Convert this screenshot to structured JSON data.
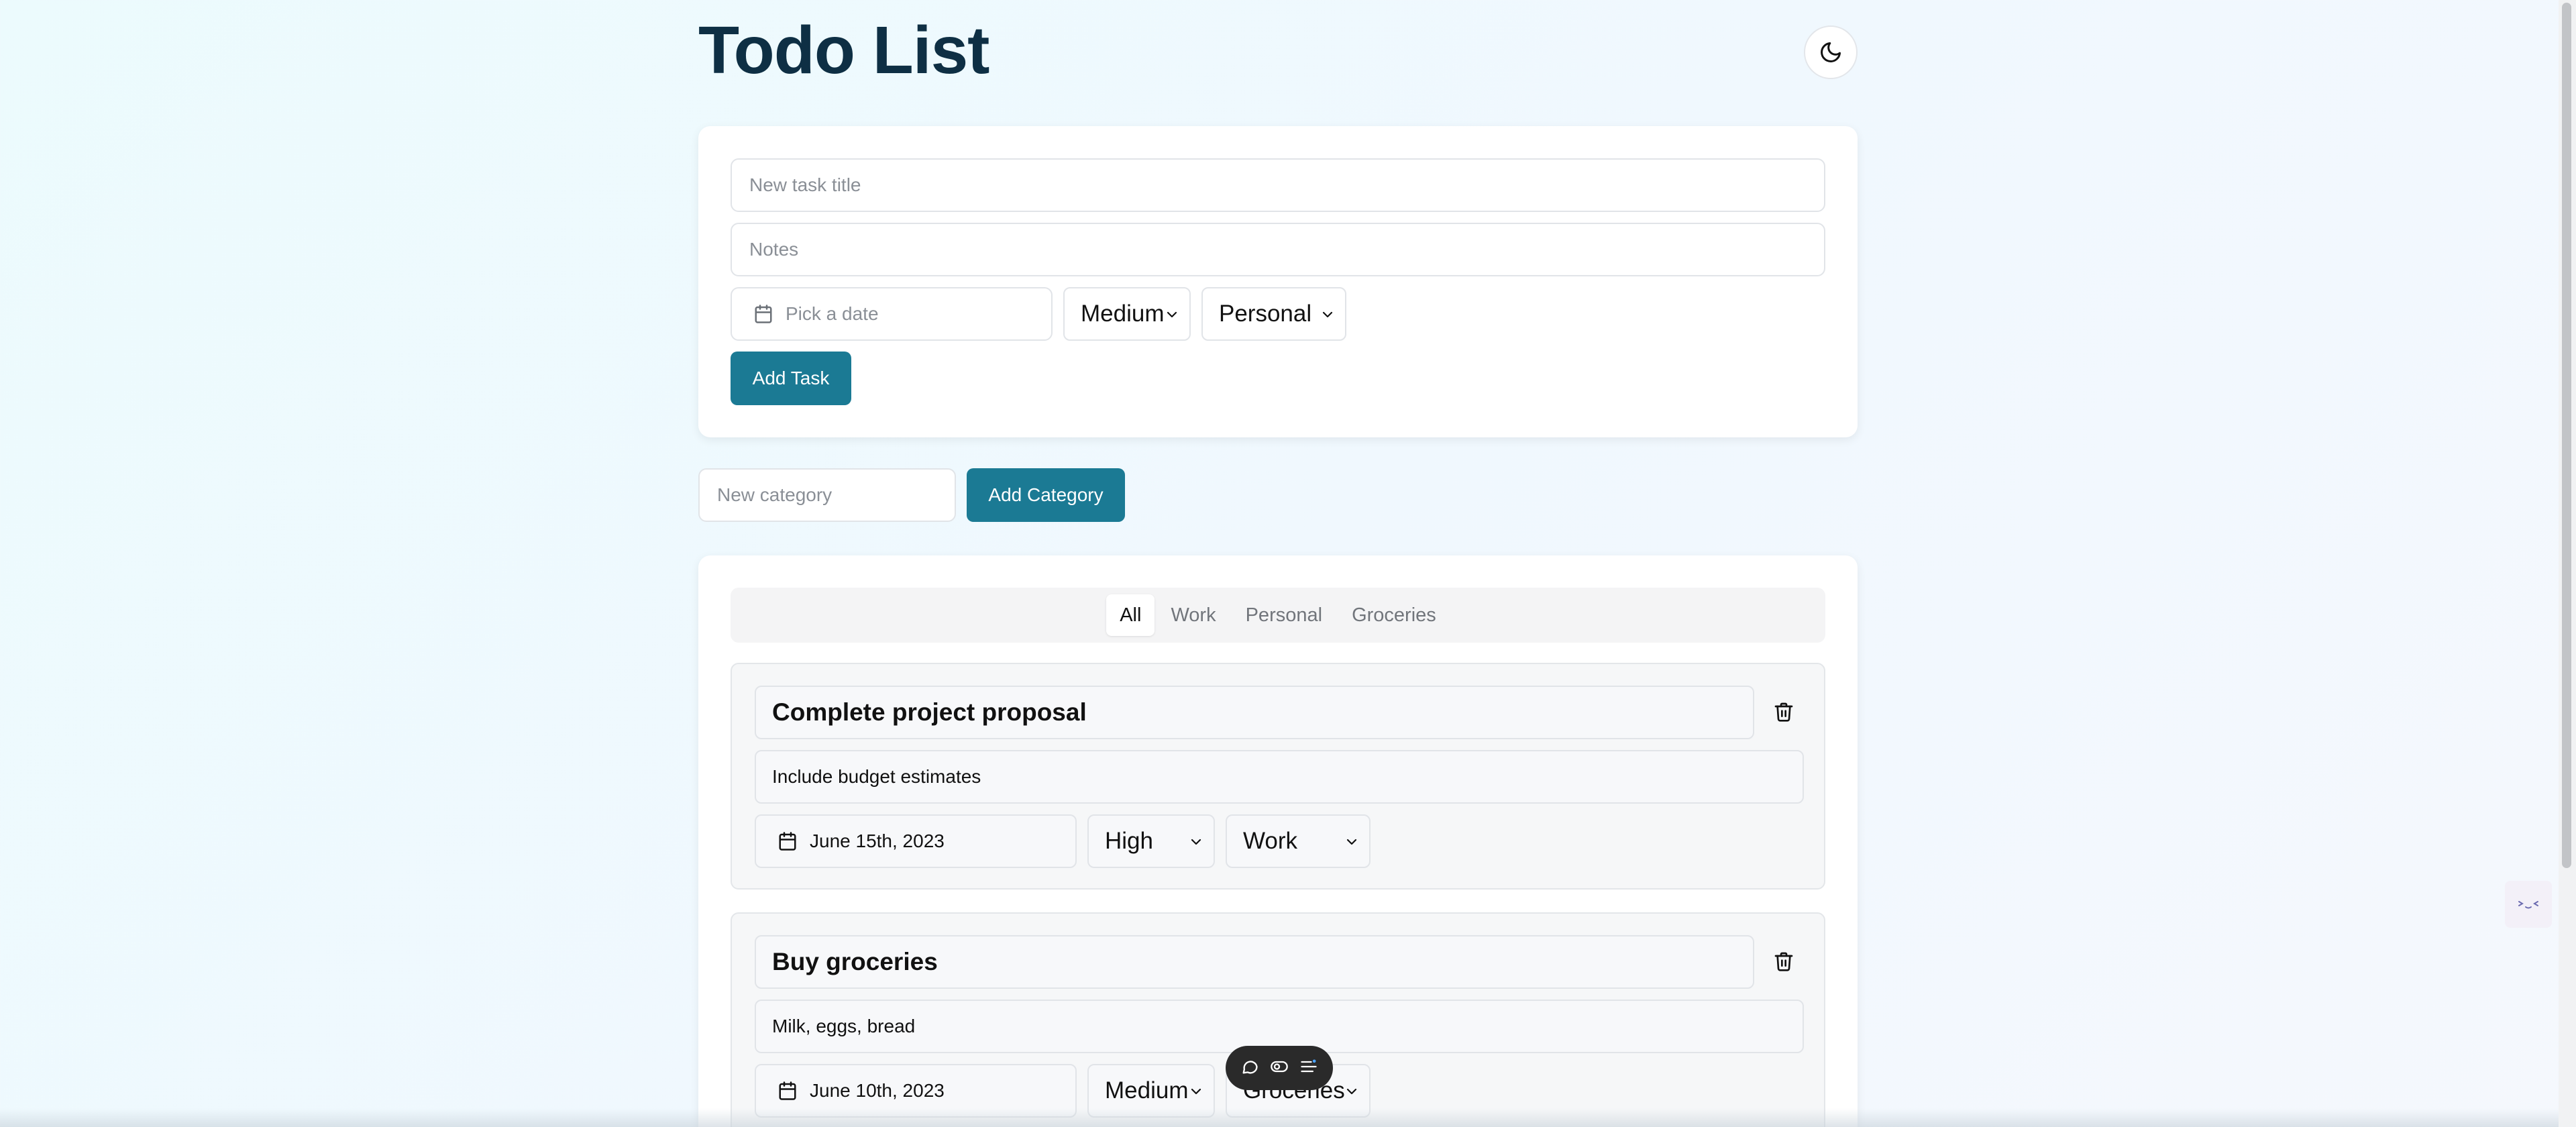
{
  "app": {
    "title": "Todo List"
  },
  "header": {
    "theme_toggle_icon": "moon-icon"
  },
  "new_task": {
    "title_placeholder": "New task title",
    "notes_placeholder": "Notes",
    "date_placeholder": "Pick a date",
    "priority_value": "Medium",
    "category_value": "Personal",
    "add_button": "Add Task"
  },
  "category_form": {
    "placeholder": "New category",
    "add_button": "Add Category"
  },
  "tabs": [
    {
      "label": "All",
      "active": true
    },
    {
      "label": "Work",
      "active": false
    },
    {
      "label": "Personal",
      "active": false
    },
    {
      "label": "Groceries",
      "active": false
    }
  ],
  "tasks": [
    {
      "title": "Complete project proposal",
      "notes": "Include budget estimates",
      "date": "June 15th, 2023",
      "priority": "High",
      "category": "Work"
    },
    {
      "title": "Buy groceries",
      "notes": "Milk, eggs, bread",
      "date": "June 10th, 2023",
      "priority": "Medium",
      "category": "Groceries"
    }
  ],
  "colors": {
    "primary": "#1b7a94",
    "title": "#0e2f44",
    "toolbar": "#2a2a2a"
  }
}
